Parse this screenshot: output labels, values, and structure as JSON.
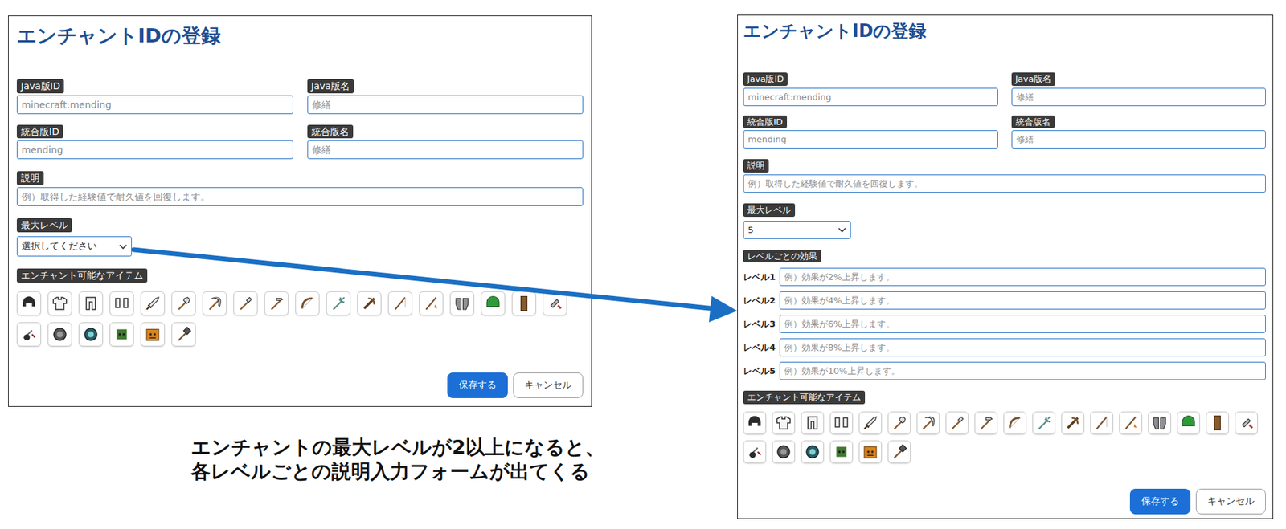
{
  "forms": [
    {
      "title": "エンチャントIDの登録",
      "id_fields": [
        {
          "label": "Java版ID",
          "placeholder": "minecraft:mending"
        },
        {
          "label": "Java版名",
          "placeholder": "修繕"
        },
        {
          "label": "統合版ID",
          "placeholder": "mending"
        },
        {
          "label": "統合版名",
          "placeholder": "修繕"
        }
      ],
      "description": {
        "label": "説明",
        "placeholder": "例）取得した経験値で耐久値を回復します。"
      },
      "max_level": {
        "label": "最大レベル",
        "value": "選択してください"
      },
      "items": {
        "label": "エンチャント可能なアイテム",
        "icons": [
          {
            "kind": "helmet"
          },
          {
            "kind": "chestplate"
          },
          {
            "kind": "leggings"
          },
          {
            "kind": "boots"
          },
          {
            "kind": "sword"
          },
          {
            "kind": "axe"
          },
          {
            "kind": "pickaxe"
          },
          {
            "kind": "shovel"
          },
          {
            "kind": "hoe"
          },
          {
            "kind": "bow"
          },
          {
            "kind": "trident"
          },
          {
            "kind": "crossbow"
          },
          {
            "kind": "fishing_rod"
          },
          {
            "kind": "carrot_on_a_stick"
          },
          {
            "kind": "elytra"
          },
          {
            "kind": "turtle_helmet"
          },
          {
            "kind": "shield"
          },
          {
            "kind": "flint_and_steel"
          },
          {
            "kind": "warped_fungus_on_a_stick"
          },
          {
            "kind": "compass"
          },
          {
            "kind": "recovery_compass"
          },
          {
            "kind": "zombie_head"
          },
          {
            "kind": "carved_pumpkin"
          },
          {
            "kind": "mace"
          }
        ]
      },
      "buttons": [
        {
          "label": "保存する",
          "kind": "primary"
        },
        {
          "label": "キャンセル",
          "kind": "secondary"
        }
      ]
    },
    {
      "title": "エンチャントIDの登録",
      "id_fields": [
        {
          "label": "Java版ID",
          "placeholder": "minecraft:mending"
        },
        {
          "label": "Java版名",
          "placeholder": "修繕"
        },
        {
          "label": "統合版ID",
          "placeholder": "mending"
        },
        {
          "label": "統合版名",
          "placeholder": "修繕"
        }
      ],
      "description": {
        "label": "説明",
        "placeholder": "例）取得した経験値で耐久値を回復します。"
      },
      "max_level": {
        "label": "最大レベル",
        "value": "5"
      },
      "level_effects": {
        "label": "レベルごとの効果",
        "levels": [
          {
            "label": "レベル1",
            "placeholder": "例）効果が2%上昇します。"
          },
          {
            "label": "レベル2",
            "placeholder": "例）効果が4%上昇します。"
          },
          {
            "label": "レベル3",
            "placeholder": "例）効果が6%上昇します。"
          },
          {
            "label": "レベル4",
            "placeholder": "例）効果が8%上昇します。"
          },
          {
            "label": "レベル5",
            "placeholder": "例）効果が10%上昇します。"
          }
        ]
      },
      "items": {
        "label": "エンチャント可能なアイテム",
        "icons": [
          {
            "kind": "helmet"
          },
          {
            "kind": "chestplate"
          },
          {
            "kind": "leggings"
          },
          {
            "kind": "boots"
          },
          {
            "kind": "sword"
          },
          {
            "kind": "axe"
          },
          {
            "kind": "pickaxe"
          },
          {
            "kind": "shovel"
          },
          {
            "kind": "hoe"
          },
          {
            "kind": "bow"
          },
          {
            "kind": "trident"
          },
          {
            "kind": "crossbow"
          },
          {
            "kind": "fishing_rod"
          },
          {
            "kind": "carrot_on_a_stick"
          },
          {
            "kind": "elytra"
          },
          {
            "kind": "turtle_helmet"
          },
          {
            "kind": "shield"
          },
          {
            "kind": "flint_and_steel"
          },
          {
            "kind": "warped_fungus_on_a_stick"
          },
          {
            "kind": "compass"
          },
          {
            "kind": "recovery_compass"
          },
          {
            "kind": "zombie_head"
          },
          {
            "kind": "carved_pumpkin"
          },
          {
            "kind": "mace"
          }
        ]
      },
      "buttons": [
        {
          "label": "保存する",
          "kind": "primary"
        },
        {
          "label": "キャンセル",
          "kind": "secondary"
        }
      ]
    }
  ],
  "caption": [
    "エンチャントの最大レベルが2以上になると、",
    "各レベルごとの説明入力フォームが出てくる"
  ]
}
